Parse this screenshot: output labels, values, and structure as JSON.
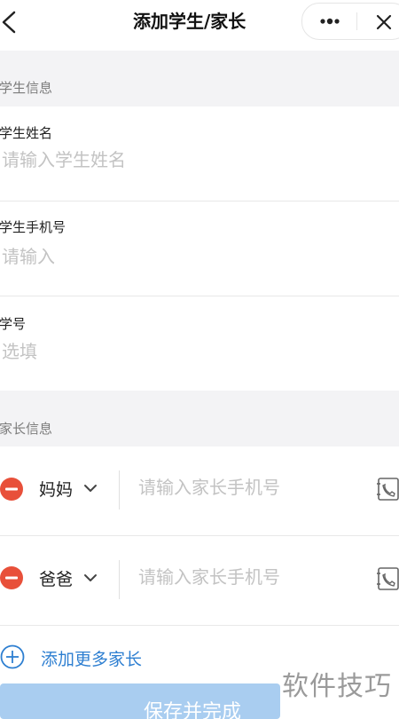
{
  "header": {
    "title": "添加学生/家长",
    "back_icon": "chevron-left-icon",
    "more_icon": "more-dots-icon",
    "close_icon": "close-icon"
  },
  "student_section": {
    "title": "学生信息",
    "fields": [
      {
        "label": "学生姓名",
        "placeholder": "请输入学生姓名",
        "value": ""
      },
      {
        "label": "学生手机号",
        "placeholder": "请输入",
        "value": ""
      },
      {
        "label": "学号",
        "placeholder": "选填",
        "value": ""
      }
    ]
  },
  "parent_section": {
    "title": "家长信息",
    "parents": [
      {
        "relation": "妈妈",
        "placeholder": "请输入家长手机号",
        "value": ""
      },
      {
        "relation": "爸爸",
        "placeholder": "请输入家长手机号",
        "value": ""
      }
    ],
    "add_label": "添加更多家长"
  },
  "footer": {
    "save_label": "保存并完成",
    "watermark": "软件技巧"
  },
  "colors": {
    "accent": "#2e7fd1",
    "remove": "#e8503a",
    "button": "#a9cdf0",
    "section_bg": "#f3f3f5"
  }
}
